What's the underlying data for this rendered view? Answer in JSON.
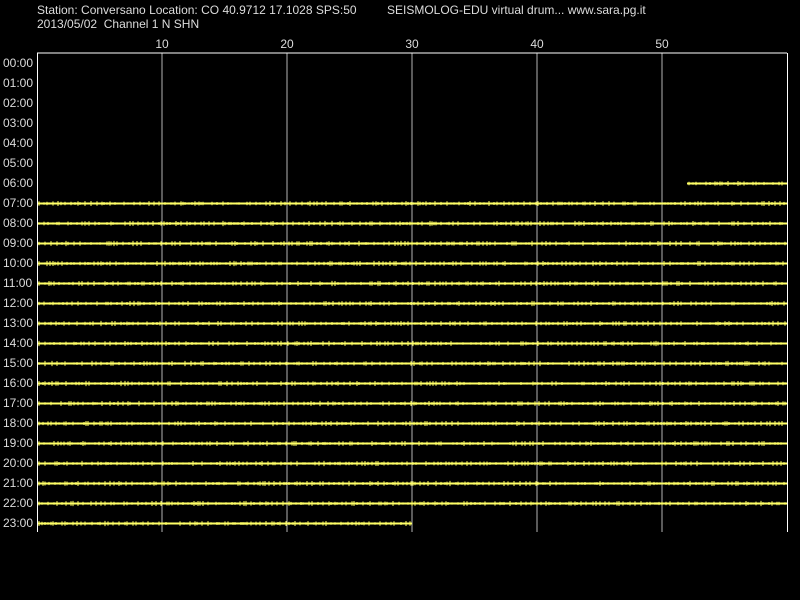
{
  "header": {
    "station_line": "Station: Conversano Location: CO 40.9712 17.1028 SPS:50",
    "date_line": "2013/05/02  Channel 1 N SHN",
    "app_line": "SEISMOLOG-EDU virtual drum... www.sara.pg.it"
  },
  "colors": {
    "background": "#000000",
    "trace": "#ffff66",
    "grid": "#b4b4b4",
    "text": "#dcdcdc"
  },
  "chart_data": {
    "type": "line",
    "title": "",
    "xlabel": "",
    "ylabel": "",
    "x_unit": "minute",
    "xlim": [
      0,
      60
    ],
    "x_ticks": [
      10,
      20,
      30,
      40,
      50
    ],
    "x_tick_labels": [
      "10",
      "20",
      "30",
      "40",
      "50"
    ],
    "y_tick_labels": [
      "00:00",
      "01:00",
      "02:00",
      "03:00",
      "04:00",
      "05:00",
      "06:00",
      "07:00",
      "08:00",
      "09:00",
      "10:00",
      "11:00",
      "12:00",
      "13:00",
      "14:00",
      "15:00",
      "16:00",
      "17:00",
      "18:00",
      "19:00",
      "20:00",
      "21:00",
      "22:00",
      "23:00"
    ],
    "grid": true,
    "series": [
      {
        "hour": "06:00",
        "start_minute": 52,
        "end_minute": 60
      },
      {
        "hour": "07:00",
        "start_minute": 0,
        "end_minute": 60
      },
      {
        "hour": "08:00",
        "start_minute": 0,
        "end_minute": 60
      },
      {
        "hour": "09:00",
        "start_minute": 0,
        "end_minute": 60
      },
      {
        "hour": "10:00",
        "start_minute": 0,
        "end_minute": 60
      },
      {
        "hour": "11:00",
        "start_minute": 0,
        "end_minute": 60
      },
      {
        "hour": "12:00",
        "start_minute": 0,
        "end_minute": 60
      },
      {
        "hour": "13:00",
        "start_minute": 0,
        "end_minute": 60
      },
      {
        "hour": "14:00",
        "start_minute": 0,
        "end_minute": 60
      },
      {
        "hour": "15:00",
        "start_minute": 0,
        "end_minute": 60
      },
      {
        "hour": "16:00",
        "start_minute": 0,
        "end_minute": 60
      },
      {
        "hour": "17:00",
        "start_minute": 0,
        "end_minute": 60
      },
      {
        "hour": "18:00",
        "start_minute": 0,
        "end_minute": 60
      },
      {
        "hour": "19:00",
        "start_minute": 0,
        "end_minute": 60
      },
      {
        "hour": "20:00",
        "start_minute": 0,
        "end_minute": 60
      },
      {
        "hour": "21:00",
        "start_minute": 0,
        "end_minute": 60
      },
      {
        "hour": "22:00",
        "start_minute": 0,
        "end_minute": 60
      },
      {
        "hour": "23:00",
        "start_minute": 0,
        "end_minute": 30
      }
    ]
  }
}
